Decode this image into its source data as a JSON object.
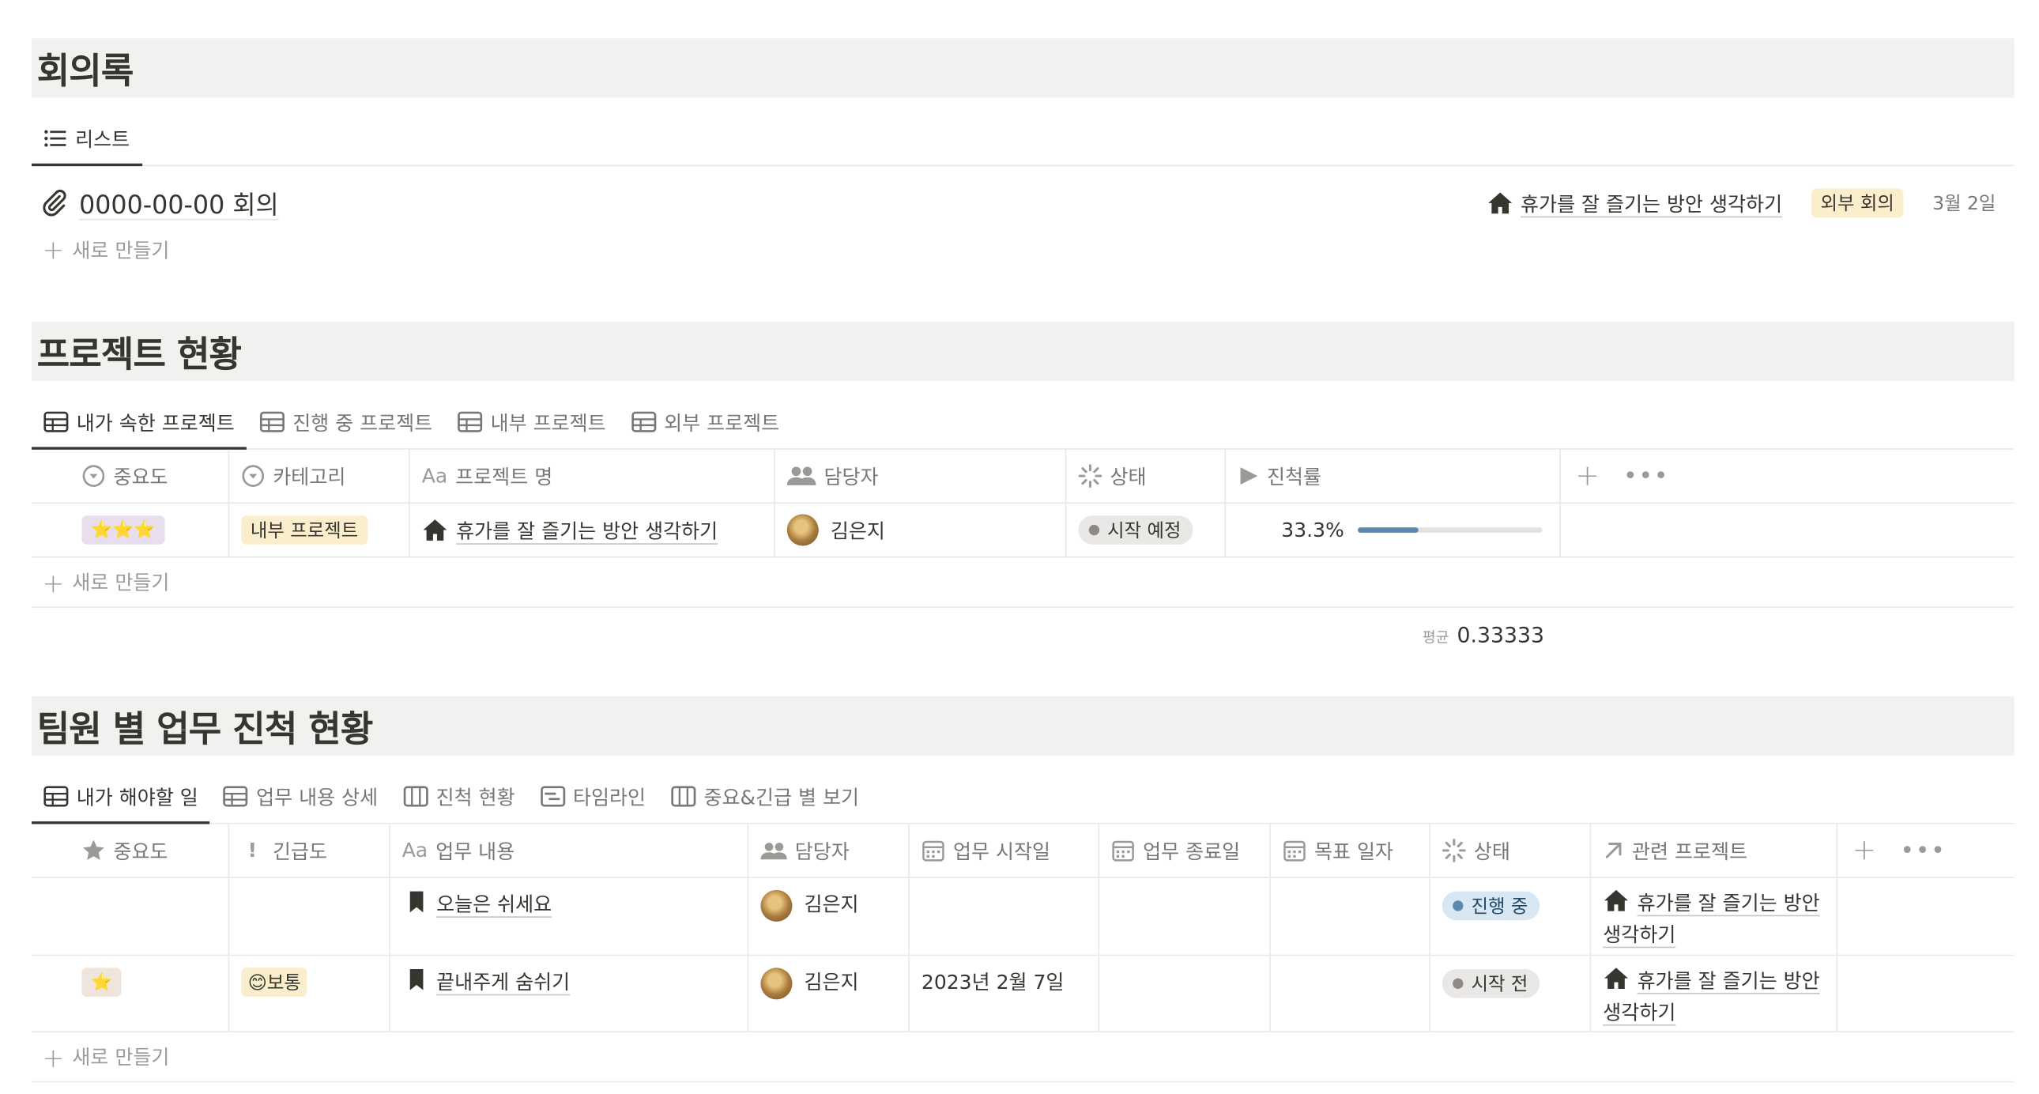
{
  "meetings": {
    "title": "회의록",
    "tab": "리스트",
    "item": {
      "title": "0000-00-00 회의",
      "project": "휴가를 잘 즐기는 방안 생각하기",
      "tag": "외부 회의",
      "date": "3월 2일"
    },
    "new_label": "새로 만들기"
  },
  "projects": {
    "title": "프로젝트 현황",
    "tabs": [
      "내가 속한 프로젝트",
      "진행 중 프로젝트",
      "내부 프로젝트",
      "외부 프로젝트"
    ],
    "columns": [
      "중요도",
      "카테고리",
      "프로젝트 명",
      "담당자",
      "상태",
      "진척률"
    ],
    "row": {
      "importance": "⭐⭐⭐",
      "category": "내부 프로젝트",
      "name": "휴가를 잘 즐기는 방안 생각하기",
      "owner": "김은지",
      "status": "시작 예정",
      "progress_label": "33.3%",
      "progress": 0.333
    },
    "new_label": "새로 만들기",
    "avg_label": "평균",
    "avg_value": "0.33333"
  },
  "tasks": {
    "title": "팀원 별 업무 진척 현황",
    "tabs": [
      "내가 해야할 일",
      "업무 내용 상세",
      "진척 현황",
      "타임라인",
      "중요&긴급 별 보기"
    ],
    "columns": [
      "중요도",
      "긴급도",
      "업무 내용",
      "담당자",
      "업무 시작일",
      "업무 종료일",
      "목표 일자",
      "상태",
      "관련 프로젝트"
    ],
    "rows": [
      {
        "importance": "",
        "urgency": "",
        "content": "오늘은 쉬세요",
        "owner": "김은지",
        "start": "",
        "end": "",
        "target": "",
        "status": "진행 중",
        "project": "휴가를 잘 즐기는 방안 생각하기"
      },
      {
        "importance": "⭐",
        "urgency": "😊보통",
        "content": "끝내주게 숨쉬기",
        "owner": "김은지",
        "start": "2023년 2월 7일",
        "end": "",
        "target": "",
        "status": "시작 전",
        "project": "휴가를 잘 즐기는 방안 생각하기"
      }
    ],
    "new_label": "새로 만들기"
  },
  "colors": {
    "accent_blue": "#5a88b1",
    "tag_yellow": "#fbeecc",
    "header_bg": "#f1f1ef"
  }
}
